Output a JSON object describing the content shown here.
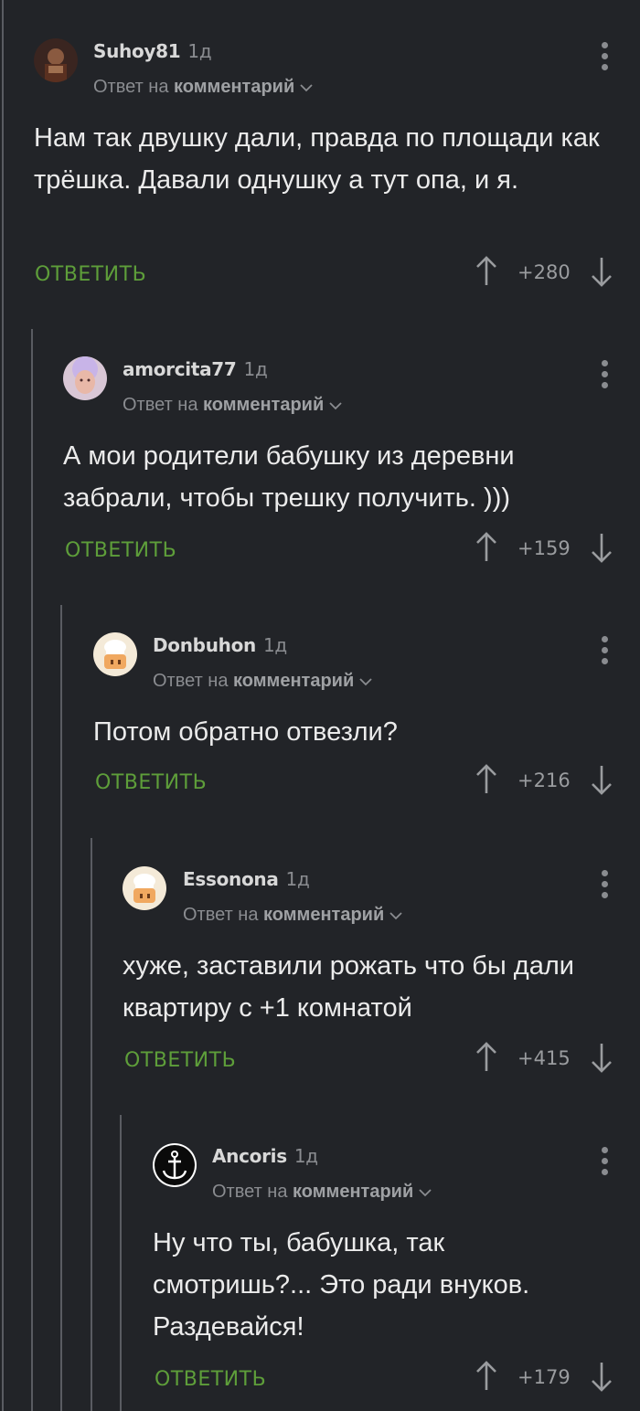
{
  "comments": [
    {
      "username": "Suhoy81",
      "age": "1д",
      "reply_prefix": "Ответ на",
      "reply_target": "комментарий",
      "text": "Нам так двушку дали, правда по площади как трёшка. Давали однушку а тут опа, и я.",
      "reply_label": "ОТВЕТИТЬ",
      "score": "+280",
      "avatar_icon": "user-photo-avatar-icon"
    },
    {
      "username": "amorcita77",
      "age": "1д",
      "reply_prefix": "Ответ на",
      "reply_target": "комментарий",
      "text": "А мои родители бабушку из деревни забрали, чтобы трешку получить. )))",
      "reply_label": "ОТВЕТИТЬ",
      "score": "+159",
      "avatar_icon": "user-photo-avatar-icon"
    },
    {
      "username": "Donbuhon",
      "age": "1д",
      "reply_prefix": "Ответ на",
      "reply_target": "комментарий",
      "text": "Потом обратно отвезли?",
      "reply_label": "ОТВЕТИТЬ",
      "score": "+216",
      "avatar_icon": "chef-avatar-icon"
    },
    {
      "username": "Essonona",
      "age": "1д",
      "reply_prefix": "Ответ на",
      "reply_target": "комментарий",
      "text": "хуже, заставили рожать что бы дали квартиру с +1 комнатой",
      "reply_label": "ОТВЕТИТЬ",
      "score": "+415",
      "avatar_icon": "chef-avatar-icon"
    },
    {
      "username": "Ancoris",
      "age": "1д",
      "reply_prefix": "Ответ на",
      "reply_target": "комментарий",
      "text": "Ну что ты, бабушка, так смотришь?... Это ради внуков. Раздевайся!",
      "reply_label": "ОТВЕТИТЬ",
      "score": "+179",
      "avatar_icon": "anchor-avatar-icon"
    }
  ],
  "colors": {
    "background": "#222428",
    "reply_button": "#5e9e3a",
    "thread_line": "#5a5c62"
  }
}
